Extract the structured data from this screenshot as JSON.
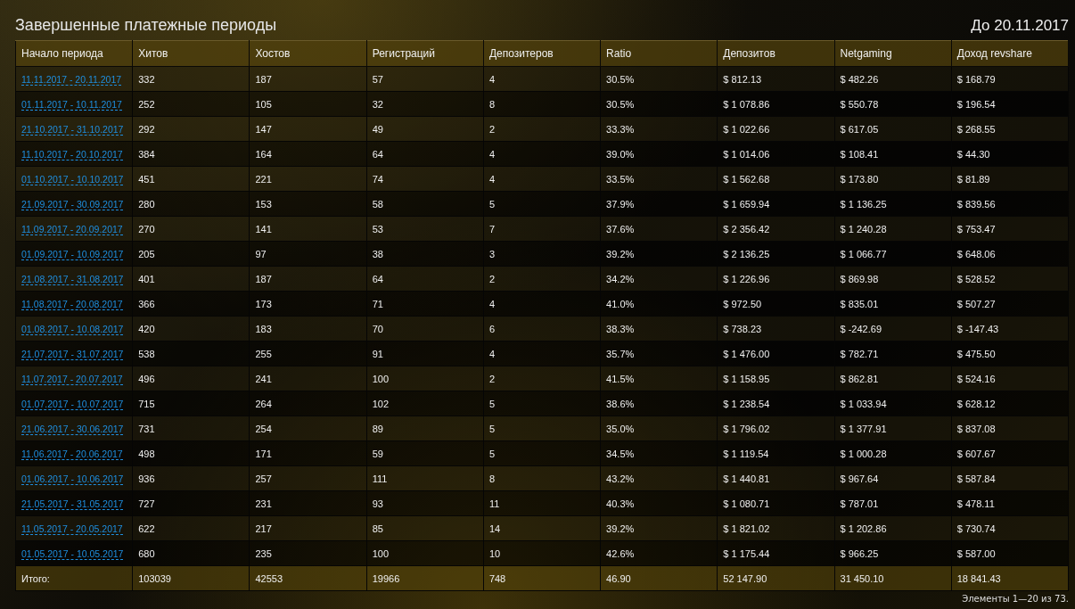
{
  "title": "Завершенные платежные периоды",
  "until": "До 20.11.2017",
  "table": {
    "columns": [
      "Начало периода",
      "Хитов",
      "Хостов",
      "Регистраций",
      "Депозитеров",
      "Ratio",
      "Депозитов",
      "Netgaming",
      "Доход revshare"
    ],
    "rows": [
      [
        "11.11.2017 - 20.11.2017",
        "332",
        "187",
        "57",
        "4",
        "30.5%",
        "$ 812.13",
        "$ 482.26",
        "$ 168.79"
      ],
      [
        "01.11.2017 - 10.11.2017",
        "252",
        "105",
        "32",
        "8",
        "30.5%",
        "$ 1 078.86",
        "$ 550.78",
        "$ 196.54"
      ],
      [
        "21.10.2017 - 31.10.2017",
        "292",
        "147",
        "49",
        "2",
        "33.3%",
        "$ 1 022.66",
        "$ 617.05",
        "$ 268.55"
      ],
      [
        "11.10.2017 - 20.10.2017",
        "384",
        "164",
        "64",
        "4",
        "39.0%",
        "$ 1 014.06",
        "$ 108.41",
        "$ 44.30"
      ],
      [
        "01.10.2017 - 10.10.2017",
        "451",
        "221",
        "74",
        "4",
        "33.5%",
        "$ 1 562.68",
        "$ 173.80",
        "$ 81.89"
      ],
      [
        "21.09.2017 - 30.09.2017",
        "280",
        "153",
        "58",
        "5",
        "37.9%",
        "$ 1 659.94",
        "$ 1 136.25",
        "$ 839.56"
      ],
      [
        "11.09.2017 - 20.09.2017",
        "270",
        "141",
        "53",
        "7",
        "37.6%",
        "$ 2 356.42",
        "$ 1 240.28",
        "$ 753.47"
      ],
      [
        "01.09.2017 - 10.09.2017",
        "205",
        "97",
        "38",
        "3",
        "39.2%",
        "$ 2 136.25",
        "$ 1 066.77",
        "$ 648.06"
      ],
      [
        "21.08.2017 - 31.08.2017",
        "401",
        "187",
        "64",
        "2",
        "34.2%",
        "$ 1 226.96",
        "$ 869.98",
        "$ 528.52"
      ],
      [
        "11.08.2017 - 20.08.2017",
        "366",
        "173",
        "71",
        "4",
        "41.0%",
        "$ 972.50",
        "$ 835.01",
        "$ 507.27"
      ],
      [
        "01.08.2017 - 10.08.2017",
        "420",
        "183",
        "70",
        "6",
        "38.3%",
        "$ 738.23",
        "$ -242.69",
        "$ -147.43"
      ],
      [
        "21.07.2017 - 31.07.2017",
        "538",
        "255",
        "91",
        "4",
        "35.7%",
        "$ 1 476.00",
        "$ 782.71",
        "$ 475.50"
      ],
      [
        "11.07.2017 - 20.07.2017",
        "496",
        "241",
        "100",
        "2",
        "41.5%",
        "$ 1 158.95",
        "$ 862.81",
        "$ 524.16"
      ],
      [
        "01.07.2017 - 10.07.2017",
        "715",
        "264",
        "102",
        "5",
        "38.6%",
        "$ 1 238.54",
        "$ 1 033.94",
        "$ 628.12"
      ],
      [
        "21.06.2017 - 30.06.2017",
        "731",
        "254",
        "89",
        "5",
        "35.0%",
        "$ 1 796.02",
        "$ 1 377.91",
        "$ 837.08"
      ],
      [
        "11.06.2017 - 20.06.2017",
        "498",
        "171",
        "59",
        "5",
        "34.5%",
        "$ 1 119.54",
        "$ 1 000.28",
        "$ 607.67"
      ],
      [
        "01.06.2017 - 10.06.2017",
        "936",
        "257",
        "111",
        "8",
        "43.2%",
        "$ 1 440.81",
        "$ 967.64",
        "$ 587.84"
      ],
      [
        "21.05.2017 - 31.05.2017",
        "727",
        "231",
        "93",
        "11",
        "40.3%",
        "$ 1 080.71",
        "$ 787.01",
        "$ 478.11"
      ],
      [
        "11.05.2017 - 20.05.2017",
        "622",
        "217",
        "85",
        "14",
        "39.2%",
        "$ 1 821.02",
        "$ 1 202.86",
        "$ 730.74"
      ],
      [
        "01.05.2017 - 10.05.2017",
        "680",
        "235",
        "100",
        "10",
        "42.6%",
        "$ 1 175.44",
        "$ 966.25",
        "$ 587.00"
      ]
    ],
    "totals": [
      "Итого:",
      "103039",
      "42553",
      "19966",
      "748",
      "46.90",
      "52 147.90",
      "31 450.10",
      "18 841.43"
    ]
  },
  "pager": "Элементы 1—20 из 73."
}
